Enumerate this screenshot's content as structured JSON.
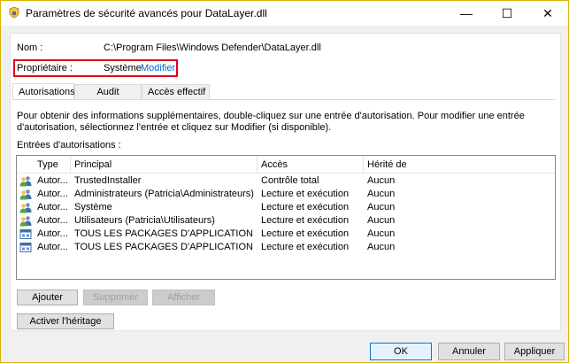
{
  "window": {
    "title": "Paramètres de sécurité avancés pour DataLayer.dll",
    "minimize_glyph": "—",
    "maximize_glyph": "☐",
    "close_glyph": "✕"
  },
  "name_row": {
    "label": "Nom :",
    "value": "C:\\Program Files\\Windows Defender\\DataLayer.dll"
  },
  "owner_row": {
    "label": "Propriétaire :",
    "value": "Système",
    "link": "Modifier",
    "highlight_color": "#e0001b"
  },
  "tabs": [
    {
      "label": "Autorisations",
      "active": true
    },
    {
      "label": "Audit",
      "active": false
    },
    {
      "label": "Accès effectif",
      "active": false
    }
  ],
  "description": "Pour obtenir des informations supplémentaires, double-cliquez sur une entrée d'autorisation. Pour modifier une entrée d'autorisation, sélectionnez l'entrée et cliquez sur Modifier (si disponible).",
  "entries_label": "Entrées d'autorisations :",
  "table": {
    "headers": [
      "Type",
      "Principal",
      "Accès",
      "Hérité de"
    ],
    "rows": [
      {
        "icon": "users-icon",
        "type": "Autor...",
        "principal": "TrustedInstaller",
        "access": "Contrôle total",
        "inherited": "Aucun"
      },
      {
        "icon": "users-icon",
        "type": "Autor...",
        "principal": "Administrateurs (Patricia\\Administrateurs)",
        "access": "Lecture et exécution",
        "inherited": "Aucun"
      },
      {
        "icon": "users-icon",
        "type": "Autor...",
        "principal": "Système",
        "access": "Lecture et exécution",
        "inherited": "Aucun"
      },
      {
        "icon": "users-icon",
        "type": "Autor...",
        "principal": "Utilisateurs (Patricia\\Utilisateurs)",
        "access": "Lecture et exécution",
        "inherited": "Aucun"
      },
      {
        "icon": "package-icon",
        "type": "Autor...",
        "principal": "TOUS LES PACKAGES D'APPLICATION",
        "access": "Lecture et exécution",
        "inherited": "Aucun"
      },
      {
        "icon": "package-icon",
        "type": "Autor...",
        "principal": "TOUS LES PACKAGES D'APPLICATION RESTREI...",
        "access": "Lecture et exécution",
        "inherited": "Aucun"
      }
    ]
  },
  "buttons": {
    "add": "Ajouter",
    "remove": "Supprimer",
    "view": "Afficher",
    "enable_inheritance": "Activer l'héritage",
    "ok": "OK",
    "cancel": "Annuler",
    "apply": "Appliquer"
  }
}
